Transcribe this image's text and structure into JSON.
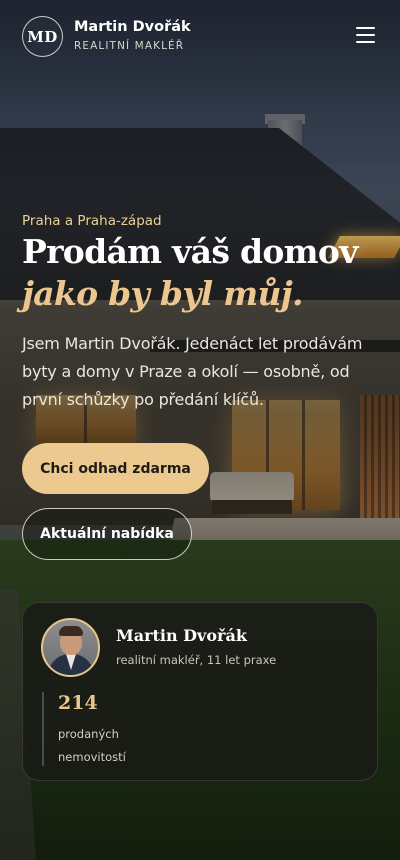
{
  "header": {
    "logo_initials": "MD",
    "brand_name": "Martin Dvořák",
    "brand_role": "REALITNÍ MAKLÉŘ",
    "menu_icon": "hamburger-menu-icon"
  },
  "hero": {
    "location": "Praha a Praha-západ",
    "title": "Prodám váš domov",
    "title_accent": "jako by byl můj.",
    "text": "Jsem Martin Dvořák. Jedenáct let prodávám byty a domy v Praze a okolí — osobně, od první schůzky po předání klíčů.",
    "primary_cta": "Chci odhad zdarma",
    "secondary_cta": "Aktuální nabídka"
  },
  "agent_card": {
    "name": "Martin Dvořák",
    "role": "realitní makléř, 11 let praxe",
    "stat_value": "214",
    "stat_label": "prodaných nemovitostí"
  },
  "colors": {
    "accent_gold": "#ecc68e",
    "button_gold": "#ecc98f",
    "card_bg": "#1a1c16"
  }
}
